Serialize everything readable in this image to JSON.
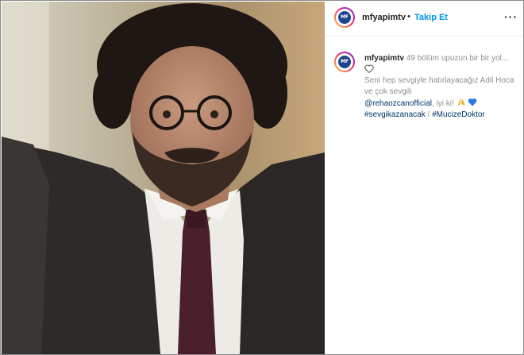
{
  "post": {
    "username": "mfyapimtv",
    "avatar_logo": "MF",
    "header": {
      "separator": "•",
      "follow_label": "Takip Et",
      "more_icon": "more-horizontal-icon"
    },
    "caption": {
      "line1": "49 bölüm upuzun bir bir yol...",
      "line2": "Seni hep sevgiyle hatırlayacağız Adil Hoca ve çok sevgili",
      "mention": "@rehaozcanofficial",
      "after_mention": ", iyi ki!",
      "hashtag1": "#sevgikazanacak",
      "hashtag_separator": " / ",
      "hashtag2": "#MucizeDoktor"
    },
    "icons": [
      "white-heart-emoji",
      "praying-hands-emoji",
      "blue-heart-emoji"
    ]
  },
  "colors": {
    "follow_blue": "#0095f6",
    "link_blue": "#00376b",
    "brand_blue": "#20438f"
  }
}
